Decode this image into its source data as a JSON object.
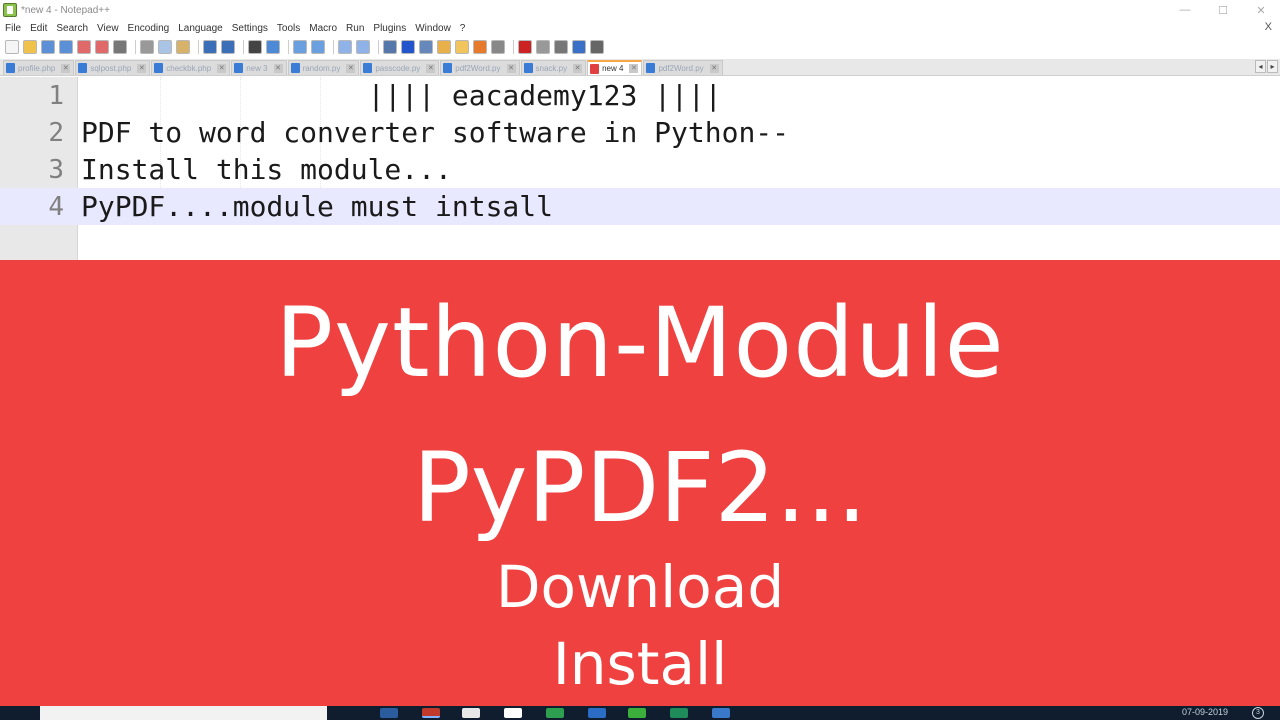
{
  "window": {
    "title": "*new 4 - Notepad++",
    "minimize": "—",
    "maximize": "☐",
    "close": "✕"
  },
  "menu": {
    "items": [
      "File",
      "Edit",
      "Search",
      "View",
      "Encoding",
      "Language",
      "Settings",
      "Tools",
      "Macro",
      "Run",
      "Plugins",
      "Window",
      "?"
    ],
    "close_doc": "X"
  },
  "toolbar": {
    "icons": [
      "new-file-icon",
      "open-file-icon",
      "save-icon",
      "save-all-icon",
      "close-icon",
      "close-all-icon",
      "print-icon",
      "cut-icon",
      "copy-icon",
      "paste-icon",
      "undo-icon",
      "redo-icon",
      "find-icon",
      "replace-icon",
      "zoom-in-icon",
      "zoom-out-icon",
      "sync-vertical-icon",
      "sync-horizontal-icon",
      "word-wrap-icon",
      "show-all-chars-icon",
      "indent-guide-icon",
      "doc-map-icon",
      "function-list-icon",
      "folder-workspace-icon",
      "monitoring-icon",
      "record-macro-icon",
      "stop-record-icon",
      "play-macro-icon",
      "run-macro-multiple-icon",
      "save-macro-icon"
    ]
  },
  "tabs": [
    {
      "label": "profile.php",
      "active": false
    },
    {
      "label": "sqlpost.php",
      "active": false
    },
    {
      "label": "checkbk.php",
      "active": false
    },
    {
      "label": "new 3",
      "active": false
    },
    {
      "label": "random.py",
      "active": false
    },
    {
      "label": "passcode.py",
      "active": false
    },
    {
      "label": "pdf2Word.py",
      "active": false
    },
    {
      "label": "snack.py",
      "active": false
    },
    {
      "label": "new 4",
      "active": true
    },
    {
      "label": "pdf2Word.py",
      "active": false
    }
  ],
  "tab_scroll": {
    "left": "◂",
    "right": "▸"
  },
  "editor": {
    "lines": [
      {
        "num": "1",
        "text": "                 |||| eacademy123 ||||"
      },
      {
        "num": "2",
        "text": "PDF to word converter software in Python--"
      },
      {
        "num": "3",
        "text": "Install this module..."
      },
      {
        "num": "4",
        "text": "PyPDF....module must intsall"
      }
    ]
  },
  "overlay": {
    "title": "Python-Module",
    "subtitle": "PyPDF2...",
    "line3": "Download",
    "line4": "Install",
    "color": "#f04141"
  },
  "taskbar": {
    "clock": "07-09-2019",
    "notification": "3"
  }
}
